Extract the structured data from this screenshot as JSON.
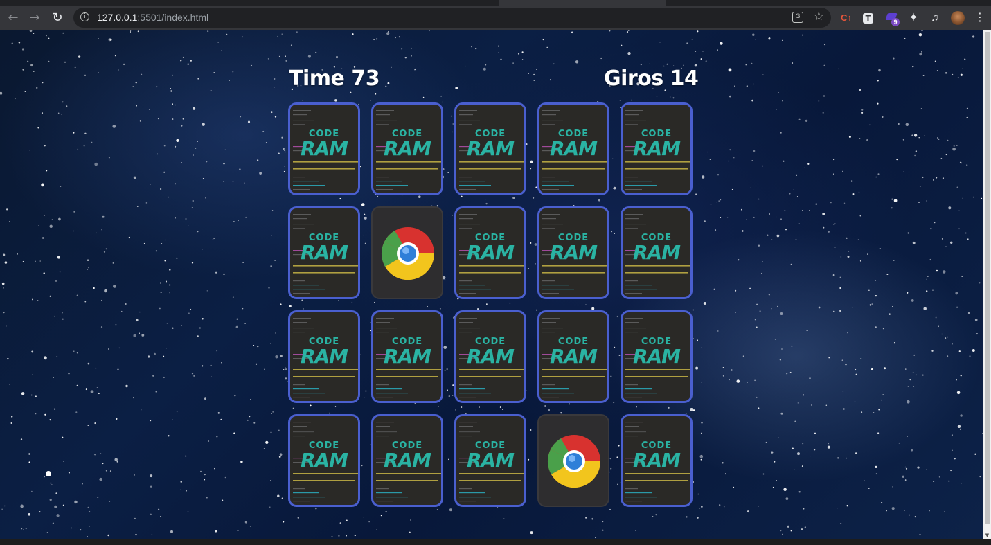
{
  "browser": {
    "url_host": "127.0.0.1",
    "url_rest": ":5501/index.html",
    "extension_badge": "9"
  },
  "hud": {
    "time_label": "Time",
    "time_value": "73",
    "moves_label": "Giros",
    "moves_value": "14"
  },
  "card_back": {
    "logo_line1": "CODE",
    "logo_line2": "RAM"
  },
  "grid": {
    "rows": 4,
    "columns": 5,
    "cards": [
      {
        "state": "face-down"
      },
      {
        "state": "face-down"
      },
      {
        "state": "face-down"
      },
      {
        "state": "face-down"
      },
      {
        "state": "face-down"
      },
      {
        "state": "face-down"
      },
      {
        "state": "face-up",
        "icon": "chrome-icon"
      },
      {
        "state": "face-down"
      },
      {
        "state": "face-down"
      },
      {
        "state": "face-down"
      },
      {
        "state": "face-down"
      },
      {
        "state": "face-down"
      },
      {
        "state": "face-down"
      },
      {
        "state": "face-down"
      },
      {
        "state": "face-down"
      },
      {
        "state": "face-down"
      },
      {
        "state": "face-down"
      },
      {
        "state": "face-down"
      },
      {
        "state": "face-up",
        "icon": "chrome-icon"
      },
      {
        "state": "face-down"
      }
    ]
  },
  "colors": {
    "card_border": "#4a5fcf",
    "logo_accent": "#2ab3a3"
  }
}
